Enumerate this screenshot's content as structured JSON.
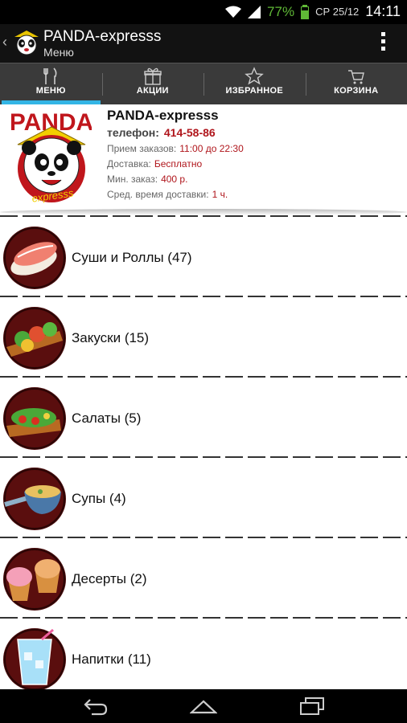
{
  "status": {
    "battery": "77%",
    "date": "СР 25/12",
    "time": "14:11"
  },
  "app_bar": {
    "title": "PANDA-expresss",
    "subtitle": "Меню"
  },
  "tabs": [
    {
      "label": "МЕНЮ",
      "icon": "fork-knife-icon"
    },
    {
      "label": "АКЦИИ",
      "icon": "gift-icon"
    },
    {
      "label": "ИЗБРАННОЕ",
      "icon": "star-icon"
    },
    {
      "label": "КОРЗИНА",
      "icon": "cart-icon"
    }
  ],
  "restaurant": {
    "name": "PANDA-expresss",
    "logo_text": "PANDA",
    "logo_sub": "expresss",
    "phone_label": "телефон:",
    "phone": "414-58-86",
    "orders_label": "Прием заказов:",
    "orders": "11:00 до 22:30",
    "delivery_label": "Доставка:",
    "delivery": "Бесплатно",
    "min_order_label": "Мин. заказ:",
    "min_order": "400 р.",
    "avg_time_label": "Сред. время доставки:",
    "avg_time": "1 ч."
  },
  "categories": [
    {
      "label": "Суши и Роллы (47)",
      "icon": "sushi-icon"
    },
    {
      "label": "Закуски (15)",
      "icon": "appetizers-icon"
    },
    {
      "label": "Салаты (5)",
      "icon": "salad-icon"
    },
    {
      "label": "Супы (4)",
      "icon": "soup-icon"
    },
    {
      "label": "Десерты (2)",
      "icon": "dessert-icon"
    },
    {
      "label": "Напитки (11)",
      "icon": "drink-icon"
    }
  ],
  "colors": {
    "accent": "#33b5e5",
    "brand_red": "#b0161c",
    "battery_green": "#5fb836"
  }
}
